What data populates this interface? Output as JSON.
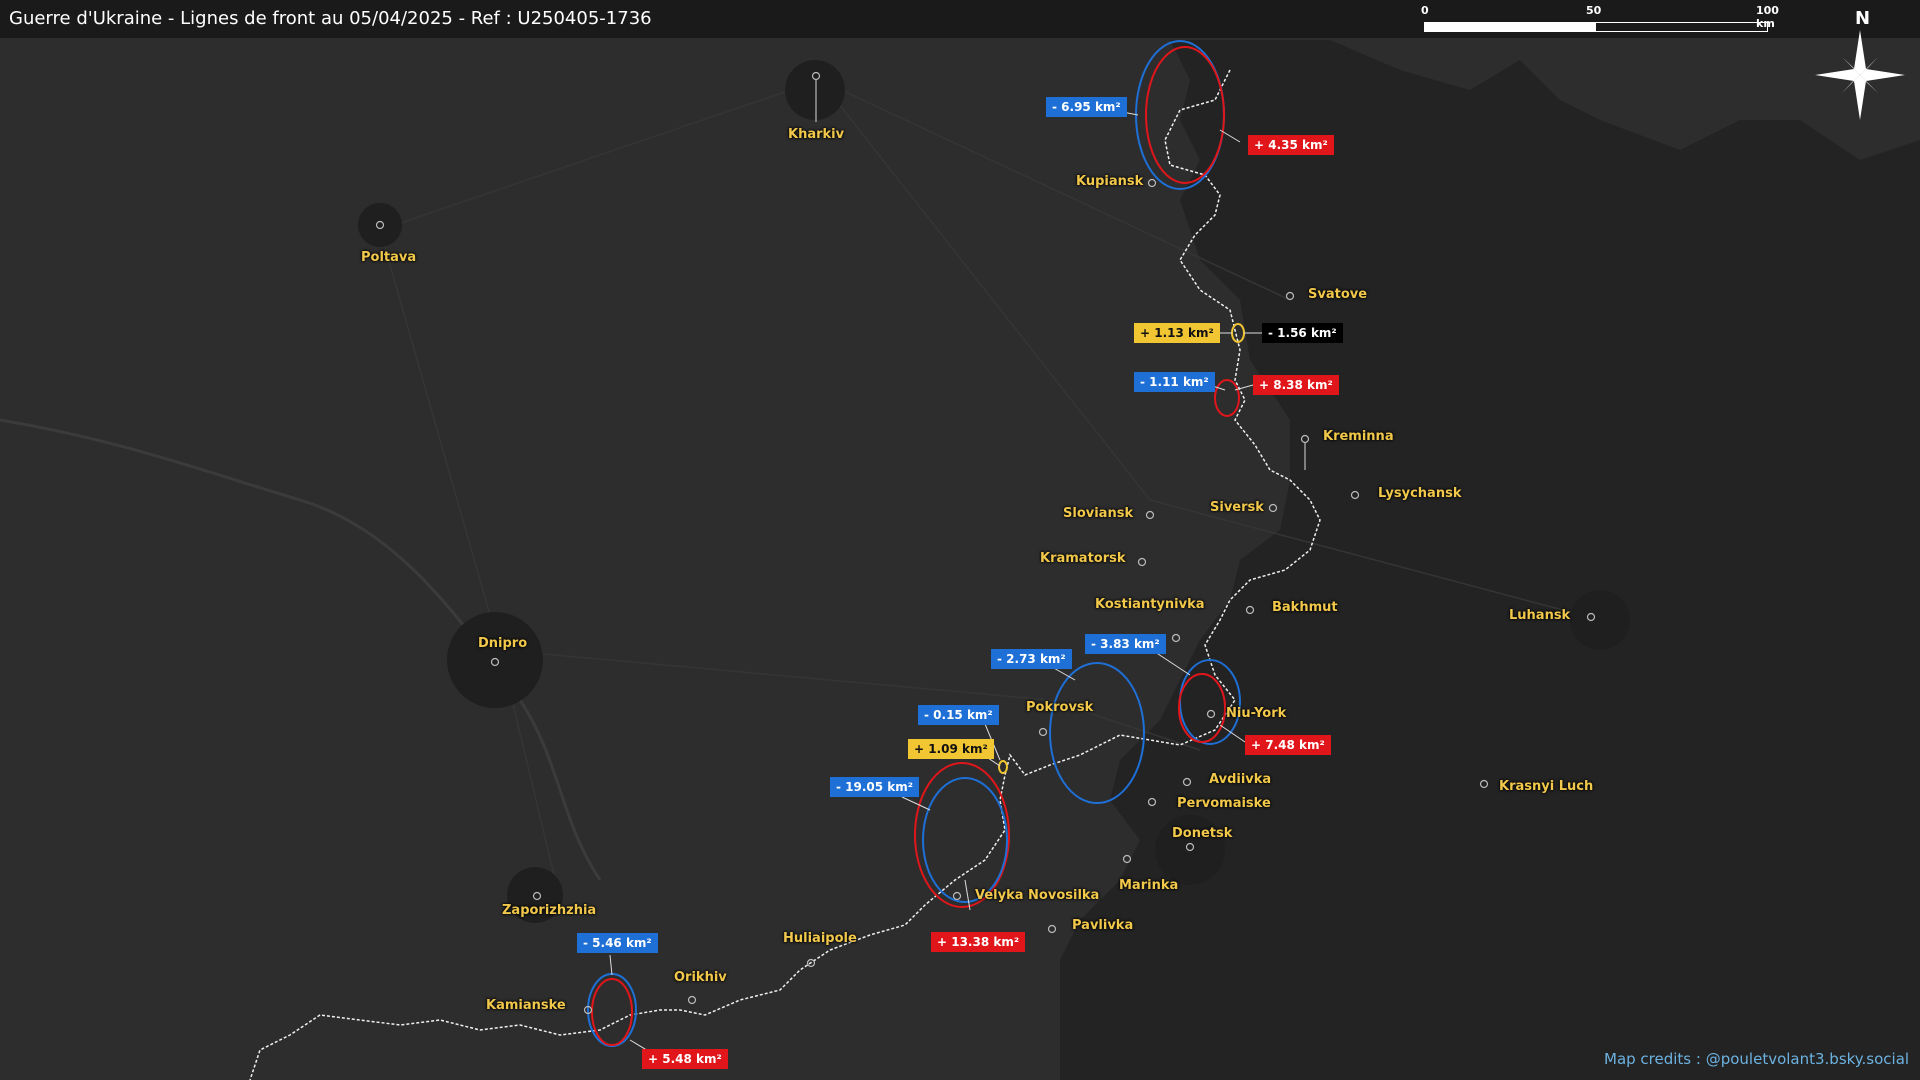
{
  "title": "Guerre d'Ukraine - Lignes de front au 05/04/2025 - Ref : U250405-1736",
  "scale": {
    "ticks": [
      "0",
      "50",
      "100 km"
    ]
  },
  "compass": {
    "north": "N",
    "icon": "compass-rose-icon"
  },
  "cities": {
    "kharkiv": "Kharkiv",
    "poltava": "Poltava",
    "kupiansk": "Kupiansk",
    "svatove": "Svatove",
    "kreminna": "Kreminna",
    "lysychansk": "Lysychansk",
    "siversk": "Siversk",
    "sloviansk": "Sloviansk",
    "kramatorsk": "Kramatorsk",
    "kostiantynivka": "Kostiantynivka",
    "bakhmut": "Bakhmut",
    "luhansk": "Luhansk",
    "dnipro": "Dnipro",
    "pokrovsk": "Pokrovsk",
    "niu_york": "Niu-York",
    "avdiivka": "Avdiivka",
    "pervomaiske": "Pervomaiske",
    "krasnyi_luch": "Krasnyi Luch",
    "donetsk": "Donetsk",
    "marinka": "Marinka",
    "velyka_novosilka": "Velyka Novosilka",
    "pavlivka": "Pavlivka",
    "huliaipole": "Huliaipole",
    "zaporizhzhia": "Zaporizhzhia",
    "orikhiv": "Orikhiv",
    "kamianske": "Kamianske"
  },
  "changes": {
    "kupiansk_loss": "- 6.95 km²",
    "kupiansk_gain": "+ 4.35 km²",
    "svatove_gain": "+ 1.13 km²",
    "svatove_loss": "- 1.56 km²",
    "kreminna_loss": "- 1.11 km²",
    "kreminna_gain": "+ 8.38 km²",
    "niuyork_loss": "- 3.83 km²",
    "niuyork_gain": "+ 7.48 km²",
    "pokrovsk_loss": "- 2.73 km²",
    "pokrovsk_small_loss": "- 0.15 km²",
    "pokrovsk_gain": "+ 1.09 km²",
    "velyka_loss": "- 19.05 km²",
    "velyka_gain": "+ 13.38 km²",
    "kamianske_loss": "- 5.46 km²",
    "kamianske_gain": "+ 5.48 km²"
  },
  "colors": {
    "loss": "#1e6fd6",
    "gain": "#e0161b",
    "minor_gain": "#f2c632",
    "minor_loss": "#000000",
    "city": "#f2c84b"
  },
  "credits": "Map credits : @pouletvolant3.bsky.social"
}
